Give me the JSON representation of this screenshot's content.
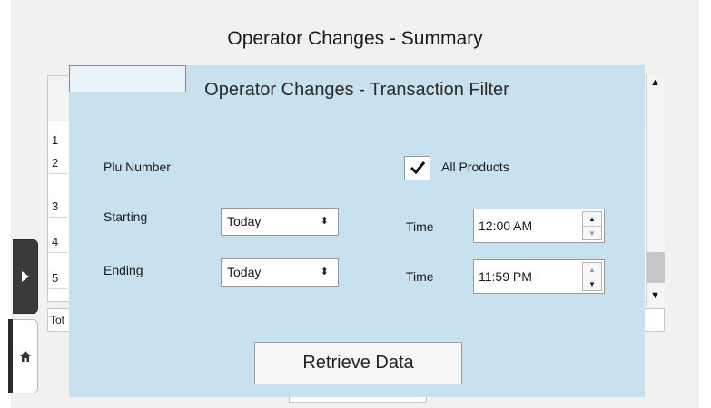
{
  "background": {
    "title": "Operator Changes - Summary",
    "rows": [
      "1",
      "2",
      "3",
      "4",
      "5"
    ],
    "total_label": "Tot"
  },
  "side_tabs": {
    "expand_icon": "chevron-right-icon",
    "home_icon": "home-icon"
  },
  "modal": {
    "title": "Operator Changes - Transaction Filter",
    "plu_label": "Plu Number",
    "plu_value": "",
    "all_products_label": "All Products",
    "all_products_checked": true,
    "starting_label": "Starting",
    "starting_value": "Today",
    "ending_label": "Ending",
    "ending_value": "Today",
    "time_label_start": "Time",
    "time_label_end": "Time",
    "start_time": "12:00 AM",
    "end_time": "11:59 PM",
    "retrieve_label": "Retrieve Data"
  },
  "colors": {
    "modal_bg": "#c7e1ee",
    "page_bg": "#f1f1f1"
  }
}
